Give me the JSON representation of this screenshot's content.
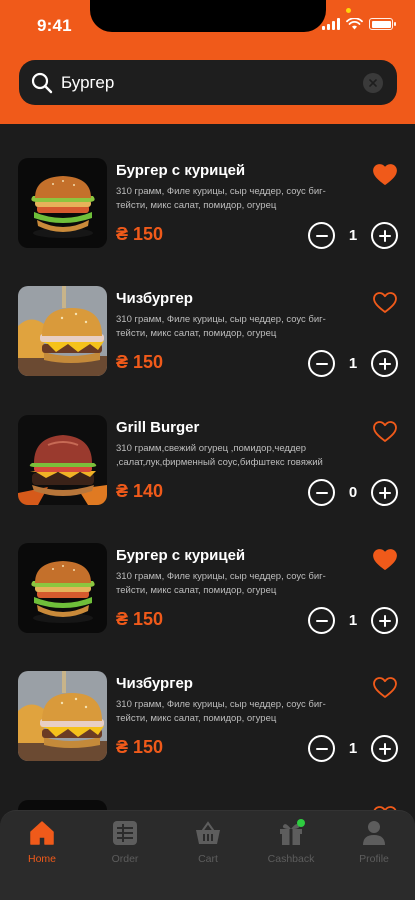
{
  "status_bar": {
    "time": "9:41"
  },
  "search": {
    "value": "Бургер",
    "icon": "search-icon",
    "clear_icon": "clear-icon"
  },
  "colors": {
    "accent": "#f05a1a",
    "background": "#1c1c1c",
    "nav_background": "#2b2b2b"
  },
  "items": [
    {
      "title": "Бургер с курицей",
      "description": "310 грамм, Филе курицы, сыр чеддер, соус биг-тейсти, микс салат, помидор, огурец",
      "price": "₴ 150",
      "quantity": "1",
      "favorite": true,
      "image": "chicken-burger-photo"
    },
    {
      "title": "Чизбургер",
      "description": "310 грамм, Филе курицы, сыр чеддер, соус биг-тейсти, микс салат, помидор, огурец",
      "price": "₴ 150",
      "quantity": "1",
      "favorite": false,
      "image": "cheeseburger-photo"
    },
    {
      "title": "Grill Burger",
      "description": "310 грамм,свежий огурец ,помидор,чеддер ,салат,лук,фирменный соус,бифштекс говяжий",
      "price": "₴ 140",
      "quantity": "0",
      "favorite": false,
      "image": "grill-burger-photo"
    },
    {
      "title": "Бургер с курицей",
      "description": "310 грамм, Филе курицы, сыр чеддер, соус биг-тейсти, микс салат, помидор, огурец",
      "price": "₴ 150",
      "quantity": "1",
      "favorite": true,
      "image": "chicken-burger-photo"
    },
    {
      "title": "Чизбургер",
      "description": "310 грамм, Филе курицы, сыр чеддер, соус биг-тейсти, микс салат, помидор, огурец",
      "price": "₴ 150",
      "quantity": "1",
      "favorite": false,
      "image": "cheeseburger-photo"
    }
  ],
  "bottom_nav": [
    {
      "label": "Home",
      "icon": "home-icon",
      "active": true
    },
    {
      "label": "Order",
      "icon": "order-icon",
      "active": false
    },
    {
      "label": "Cart",
      "icon": "cart-icon",
      "active": false
    },
    {
      "label": "Cashback",
      "icon": "gift-icon",
      "active": false,
      "badge_color": "#2ecc40"
    },
    {
      "label": "Profile",
      "icon": "profile-icon",
      "active": false
    }
  ]
}
